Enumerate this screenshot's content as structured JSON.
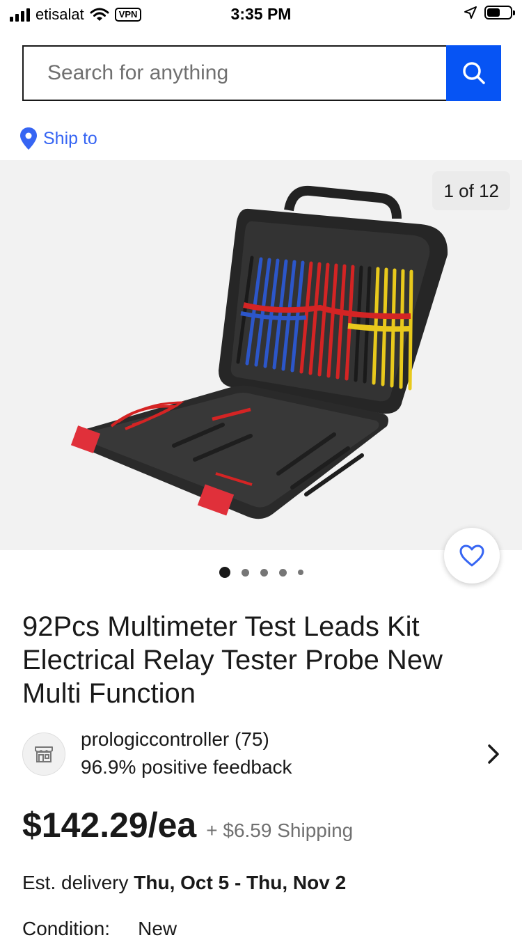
{
  "status_bar": {
    "carrier": "etisalat",
    "vpn": "VPN",
    "time": "3:35 PM",
    "battery_level": 0.55
  },
  "search": {
    "placeholder": "Search for anything"
  },
  "ship_to": {
    "label": "Ship to"
  },
  "gallery": {
    "counter": "1 of 12",
    "current_index": 1,
    "total": 12,
    "dots": 5
  },
  "product": {
    "title": "92Pcs Multimeter Test Leads Kit Electrical Relay Tester Probe New Multi Function"
  },
  "seller": {
    "name": "prologiccontroller (75)",
    "feedback": "96.9% positive feedback"
  },
  "pricing": {
    "price": "$142.29/ea",
    "shipping": "+ $6.59 Shipping"
  },
  "delivery": {
    "label": "Est. delivery",
    "dates": "Thu, Oct 5 - Thu, Nov 2"
  },
  "condition": {
    "label": "Condition:",
    "value": "New"
  },
  "colors": {
    "accent_blue": "#3665f3",
    "search_button": "#0654f4",
    "text": "#191919",
    "muted": "#707070"
  },
  "icons": [
    "signal-icon",
    "wifi-icon",
    "location-arrow-icon",
    "battery-icon",
    "search-icon",
    "location-pin-icon",
    "heart-icon",
    "store-icon",
    "chevron-right-icon"
  ]
}
